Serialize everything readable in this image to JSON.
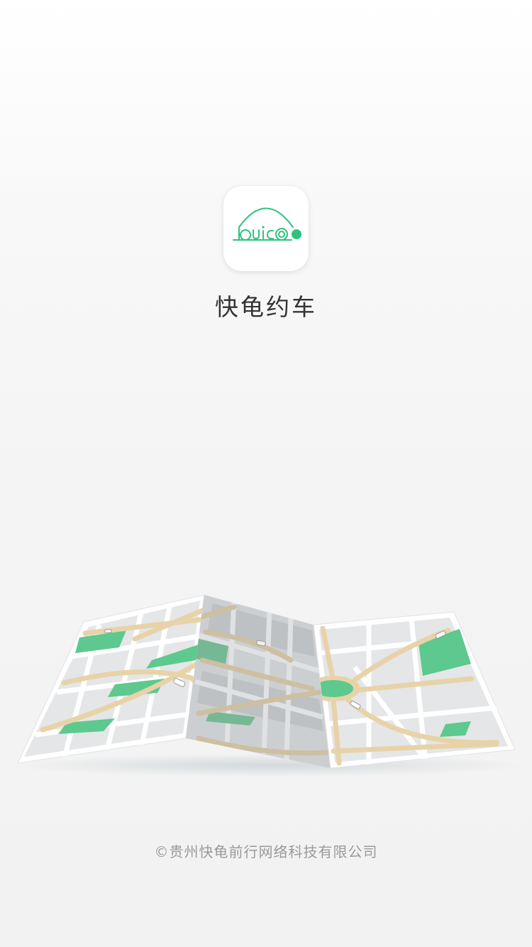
{
  "app": {
    "name": "快龟约车",
    "logo_text": "Quicoo",
    "brand_color": "#2ec27e"
  },
  "illustration": {
    "name": "folded-city-map",
    "road_color": "#e8d2a8",
    "park_color": "#5dc98e",
    "block_color": "#e3e5e6"
  },
  "footer": {
    "copyright": "©贵州快龟前行网络科技有限公司"
  }
}
